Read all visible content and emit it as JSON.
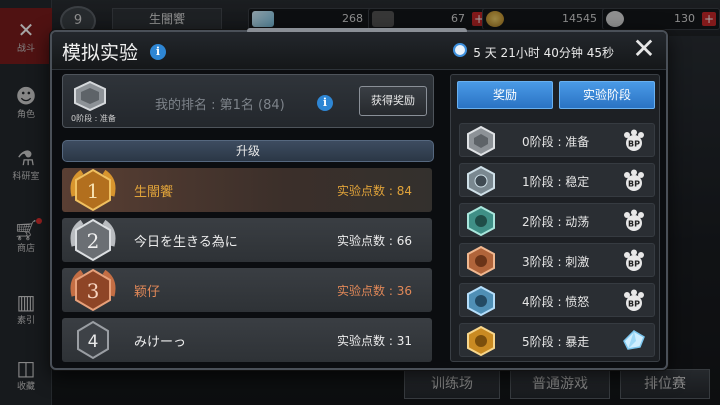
{
  "nav": [
    {
      "label": "战斗",
      "icon": "battle-icon"
    },
    {
      "label": "角色",
      "icon": "character-icon"
    },
    {
      "label": "科研室",
      "icon": "lab-icon"
    },
    {
      "label": "商店",
      "icon": "shop-icon"
    },
    {
      "label": "素引",
      "icon": "index-icon"
    },
    {
      "label": "收藏",
      "icon": "collection-icon"
    }
  ],
  "topbar": {
    "level": "9",
    "player_name": "生闇饗",
    "resources": [
      {
        "value": "268",
        "icon": "diamond-icon"
      },
      {
        "value": "67",
        "icon": "ticket-icon"
      },
      {
        "value": "14545",
        "icon": "coin-icon"
      },
      {
        "value": "130",
        "icon": "bp-icon"
      }
    ]
  },
  "background_buttons": {
    "training": "训练场",
    "normal": "普通游戏",
    "ranked": "排位赛"
  },
  "modal": {
    "title": "模拟实验",
    "timer": "5 天 21小时 40分钟 45秒",
    "my_stage_caption": "0阶段 : 准备",
    "my_rank": "我的排名 : 第1名 (84)",
    "claim_label": "获得奖励",
    "section_title": "升级",
    "points_label": "实验点数",
    "leaderboard": [
      {
        "rank": "1",
        "name": "生闇饗",
        "points": "84"
      },
      {
        "rank": "2",
        "name": "今日を生きる為に",
        "points": "66"
      },
      {
        "rank": "3",
        "name": "颖仔",
        "points": "36"
      },
      {
        "rank": "4",
        "name": "みけーっ",
        "points": "31"
      }
    ],
    "tabs": {
      "rewards": "奖励",
      "stages": "实验阶段"
    },
    "stages": [
      {
        "label": "0阶段 : 准备",
        "reward": "bp-paw-icon"
      },
      {
        "label": "1阶段 : 稳定",
        "reward": "bp-paw-icon"
      },
      {
        "label": "2阶段 : 动荡",
        "reward": "bp-paw-icon"
      },
      {
        "label": "3阶段 : 刺激",
        "reward": "bp-paw-icon"
      },
      {
        "label": "4阶段 : 愤怒",
        "reward": "bp-paw-icon"
      },
      {
        "label": "5阶段 : 暴走",
        "reward": "crystal-icon"
      }
    ],
    "colors": {
      "accent_blue": "#2a73c4",
      "gold": "#e0a33a",
      "silver": "#c9ccd0",
      "bronze": "#d77a4e",
      "rank_point_first": "#e0a33a"
    }
  }
}
